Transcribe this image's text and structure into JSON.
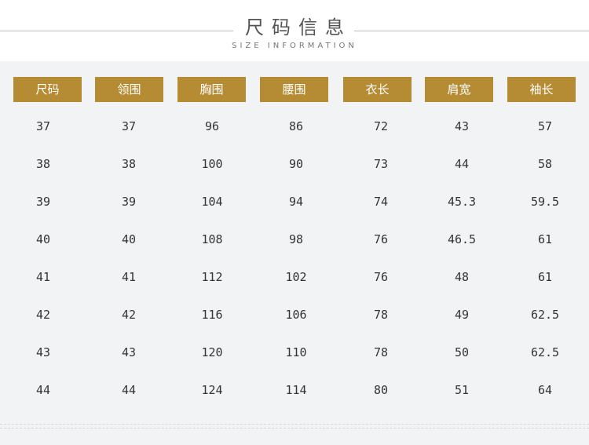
{
  "header": {
    "title": "尺码信息",
    "subtitle": "SIZE INFORMATION"
  },
  "table": {
    "columns": [
      "尺码",
      "领围",
      "胸围",
      "腰围",
      "衣长",
      "肩宽",
      "袖长"
    ],
    "rows": [
      [
        "37",
        "37",
        "96",
        "86",
        "72",
        "43",
        "57"
      ],
      [
        "38",
        "38",
        "100",
        "90",
        "73",
        "44",
        "58"
      ],
      [
        "39",
        "39",
        "104",
        "94",
        "74",
        "45.3",
        "59.5"
      ],
      [
        "40",
        "40",
        "108",
        "98",
        "76",
        "46.5",
        "61"
      ],
      [
        "41",
        "41",
        "112",
        "102",
        "76",
        "48",
        "61"
      ],
      [
        "42",
        "42",
        "116",
        "106",
        "78",
        "49",
        "62.5"
      ],
      [
        "43",
        "43",
        "120",
        "110",
        "78",
        "50",
        "62.5"
      ],
      [
        "44",
        "44",
        "124",
        "114",
        "80",
        "51",
        "64"
      ]
    ]
  },
  "colors": {
    "header_bg": "#b58c34",
    "panel_bg": "#f2f3f5",
    "text": "#333333"
  }
}
